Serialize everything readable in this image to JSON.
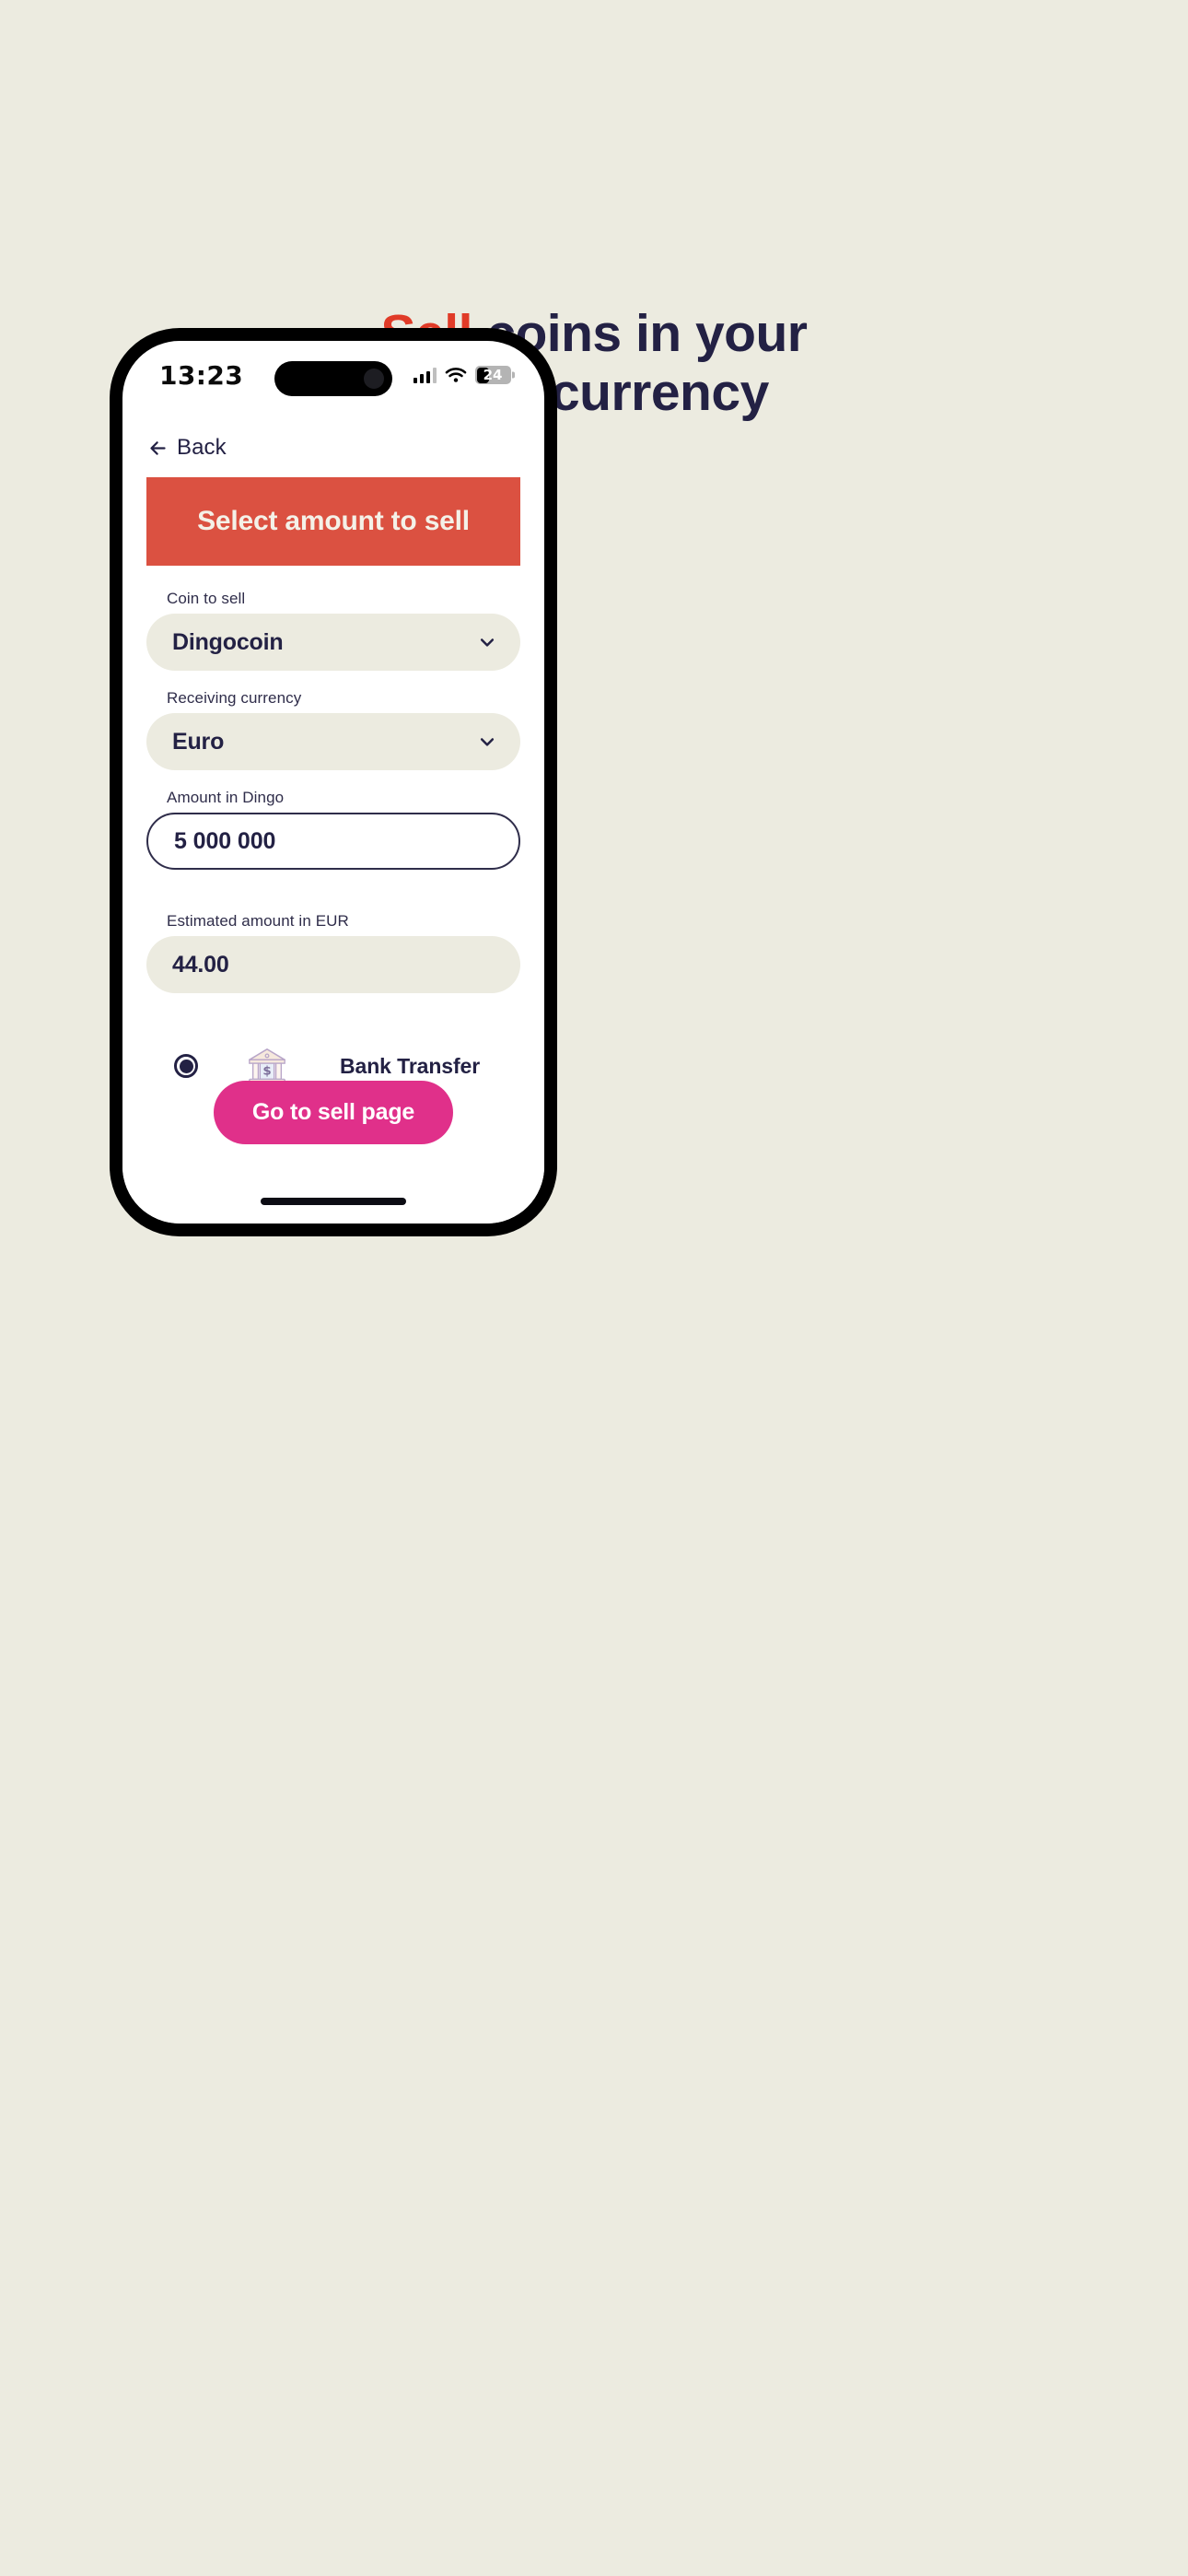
{
  "page": {
    "background_color": "#ecebe0",
    "headline": {
      "accent_word": "Sell",
      "rest_line1": " coins in your",
      "line2": "local currency",
      "accent_color": "#e03b28",
      "text_color": "#232144"
    }
  },
  "phone": {
    "status_bar": {
      "time": "13:23",
      "signal_icon": "cellular-signal-icon",
      "wifi_icon": "wifi-icon",
      "battery_level": "24",
      "battery_icon": "battery-icon"
    },
    "home_indicator": "home-indicator"
  },
  "app": {
    "back": {
      "label": "Back",
      "icon": "arrow-left-icon"
    },
    "banner": {
      "title": "Select amount to sell",
      "background_color": "#db5141",
      "text_color": "#f4f1e8"
    },
    "fields": {
      "coin_to_sell": {
        "label": "Coin to sell",
        "value": "Dingocoin",
        "icon": "chevron-down-icon"
      },
      "receiving_currency": {
        "label": "Receiving currency",
        "value": "Euro",
        "icon": "chevron-down-icon"
      },
      "amount_in_dingo": {
        "label": "Amount in Dingo",
        "value": "5 000 000",
        "placeholder": "5 000 000"
      },
      "estimated_amount": {
        "label": "Estimated amount in EUR",
        "value": "44.00"
      }
    },
    "payment_method": {
      "label": "Bank Transfer",
      "icon": "bank-building-icon",
      "radio": "radio-selected",
      "selected": "true"
    },
    "cta": {
      "label": "Go to sell page",
      "background_color": "#e0308a",
      "text_color": "#ffffff"
    }
  }
}
